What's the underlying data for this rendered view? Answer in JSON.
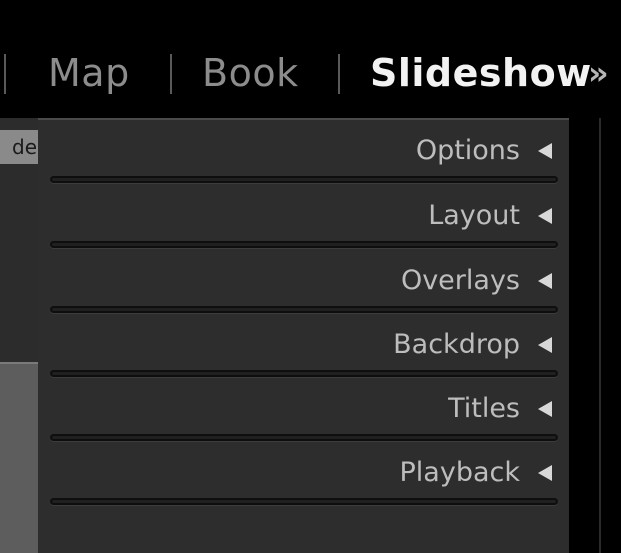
{
  "module_picker": {
    "tabs": [
      {
        "label": "Map",
        "active": false
      },
      {
        "label": "Book",
        "active": false
      },
      {
        "label": "Slideshow",
        "active": true
      }
    ],
    "more_glyph": "»"
  },
  "left_panel": {
    "button_label": "de"
  },
  "right_panel": {
    "sections": [
      {
        "label": "Options",
        "icon": "collapse-left-triangle-icon"
      },
      {
        "label": "Layout",
        "icon": "collapse-left-triangle-icon"
      },
      {
        "label": "Overlays",
        "icon": "collapse-left-triangle-icon"
      },
      {
        "label": "Backdrop",
        "icon": "collapse-left-triangle-icon"
      },
      {
        "label": "Titles",
        "icon": "collapse-left-triangle-icon"
      },
      {
        "label": "Playback",
        "icon": "collapse-left-triangle-icon"
      }
    ]
  },
  "colors": {
    "background": "#000000",
    "panel": "#2d2d2d",
    "active_tab": "#f2f2f2",
    "inactive_tab": "#8c8c8c",
    "section_label": "#bdbdbd"
  }
}
